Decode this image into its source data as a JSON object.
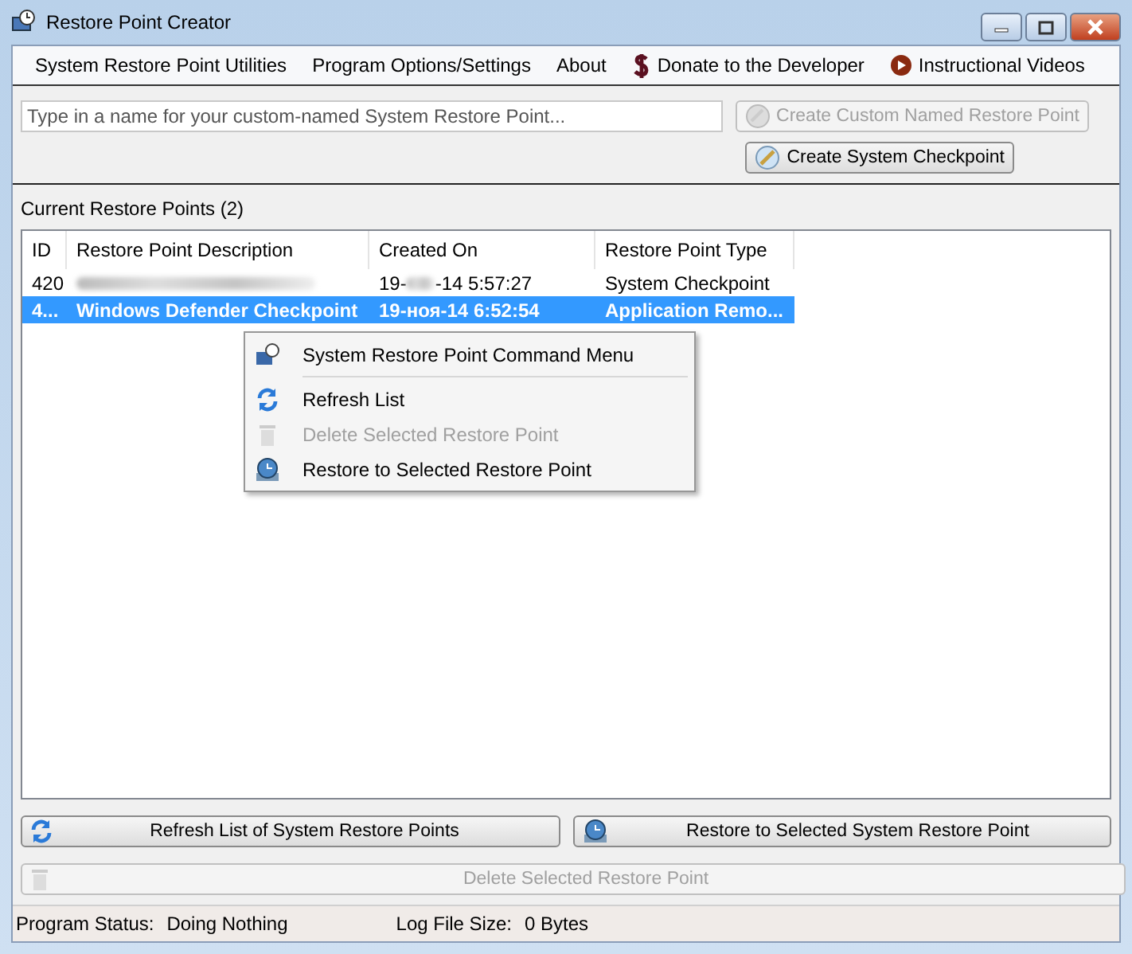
{
  "window": {
    "title": "Restore Point Creator"
  },
  "menu": [
    {
      "label": "System Restore Point Utilities",
      "kind": "plain"
    },
    {
      "label": "Program Options/Settings",
      "kind": "plain"
    },
    {
      "label": "About",
      "kind": "plain"
    },
    {
      "label": "Donate to the Developer",
      "kind": "donate"
    },
    {
      "label": "Instructional Videos",
      "kind": "video"
    }
  ],
  "name_field": {
    "placeholder": "Type in a name for your custom-named System Restore Point..."
  },
  "create_named_button": {
    "label": "Create Custom Named Restore Point",
    "disabled": true
  },
  "checkpoint_button": {
    "label": "Create System Checkpoint",
    "disabled": false
  },
  "restore_points": {
    "label": "Current Restore Points (2)",
    "columns": [
      "ID",
      "Restore Point Description",
      "Created On",
      "Restore Point Type"
    ],
    "rows": [
      {
        "id": "420",
        "description": "",
        "blurred": true,
        "created_on": [
          "19-",
          "-14 5:57:27"
        ],
        "type": "System Checkpoint",
        "selected": false
      },
      {
        "id": "4...",
        "description": "Windows Defender Checkpoint",
        "blurred": false,
        "created_on": [
          "19-ноя-14 6:52:54"
        ],
        "type": "Application Remo...",
        "selected": true
      }
    ]
  },
  "context_menu": [
    {
      "kind": "header",
      "label": "System Restore Point Command Menu",
      "disabled": false
    },
    {
      "kind": "separator"
    },
    {
      "kind": "refresh",
      "label": "Refresh List",
      "disabled": false
    },
    {
      "kind": "delete",
      "label": "Delete Selected Restore Point",
      "disabled": true
    },
    {
      "kind": "restore",
      "label": "Restore to Selected Restore Point",
      "disabled": false
    }
  ],
  "buttons": [
    {
      "kind": "refresh",
      "label": "Refresh List of System Restore Points",
      "disabled": false
    },
    {
      "kind": "restore",
      "label": "Restore to Selected System Restore Point",
      "disabled": false
    },
    {
      "kind": "delete",
      "label": "Delete Selected Restore Point",
      "disabled": true
    }
  ],
  "status_bar": {
    "status_label": "Program Status:",
    "status_value": "Doing Nothing",
    "log_label": "Log File Size:",
    "log_value": "0 Bytes"
  }
}
